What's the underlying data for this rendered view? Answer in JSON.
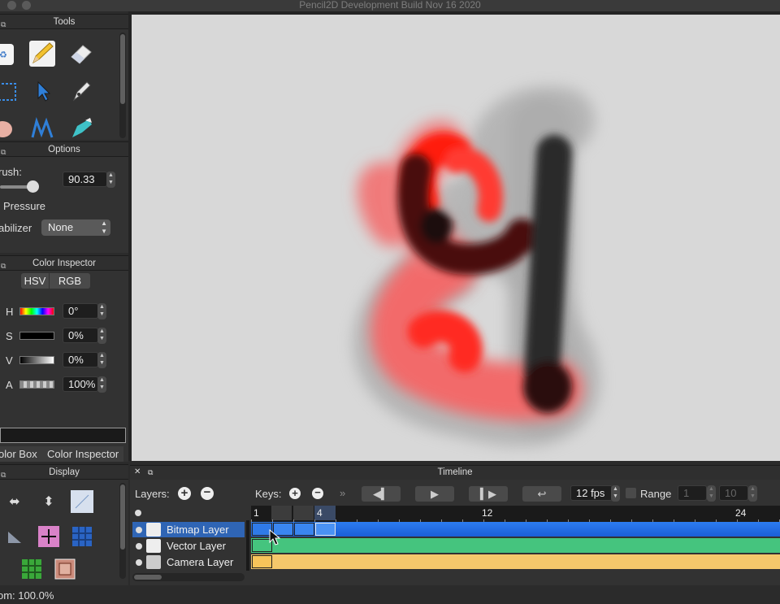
{
  "window": {
    "title": "Pencil2D Development Build Nov 16 2020"
  },
  "tools_panel": {
    "title": "Tools",
    "tools": [
      "clear-icon",
      "pencil-icon",
      "eraser-icon",
      "select-icon",
      "move-icon",
      "pen-icon",
      "hand-icon",
      "polyline-icon",
      "bucket-icon"
    ]
  },
  "options_panel": {
    "title": "Options",
    "brush_label": "rush:",
    "brush_value": "90.33",
    "brush_slider_fraction": 0.55,
    "pressure_label": "Pressure",
    "stabilizer_label": "abilizer",
    "stabilizer_value": "None"
  },
  "color_inspector": {
    "title": "Color Inspector",
    "tabs": [
      "HSV",
      "RGB"
    ],
    "rows": [
      {
        "label": "H",
        "value": "0°"
      },
      {
        "label": "S",
        "value": "0%"
      },
      {
        "label": "V",
        "value": "0%"
      },
      {
        "label": "A",
        "value": "100%"
      }
    ],
    "bottom_tabs": [
      "olor Box",
      "Color Inspector"
    ]
  },
  "display_panel": {
    "title": "Display",
    "buttons": [
      "horizontal-flip-icon",
      "vertical-flip-icon",
      "overlay-icon",
      "perspective-icon",
      "center-cross-icon",
      "grid-icon",
      "thirds-grid-icon",
      "safe-area-icon"
    ]
  },
  "timeline": {
    "title": "Timeline",
    "layers_label": "Layers:",
    "keys_label": "Keys:",
    "fps": "12 fps",
    "range_label": "Range",
    "range_start": "1",
    "range_end": "10",
    "ruler": {
      "frame1": "1",
      "frame4": "4",
      "frame12": "12",
      "frame24": "24"
    },
    "layers": [
      {
        "name": "Bitmap Layer",
        "color": "#1f6de8",
        "selected": true
      },
      {
        "name": "Vector Layer",
        "color": "#45c47e",
        "selected": false
      },
      {
        "name": "Camera Layer",
        "color": "#f5c86b",
        "selected": false
      }
    ]
  },
  "status": {
    "zoom": "om: 100.0%"
  },
  "colors": {
    "accent": "#2f65b5",
    "canvas": "#d8d8d8",
    "red_stroke": "#ff1a10"
  }
}
